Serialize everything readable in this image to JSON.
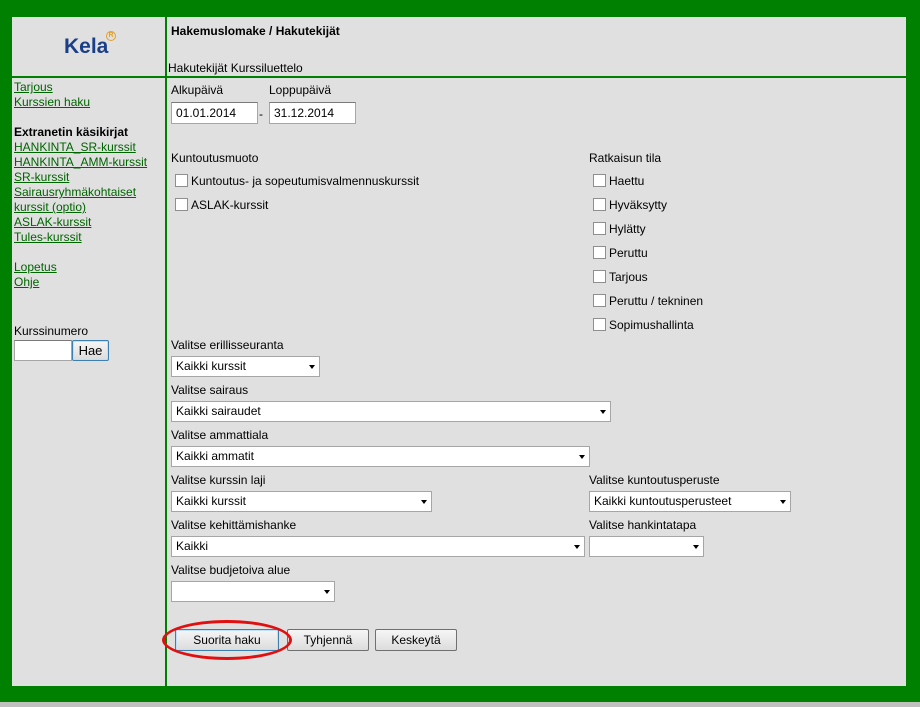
{
  "logo": {
    "text": "Kela",
    "mark": "R"
  },
  "header": {
    "title": "Hakemuslomake / Hakutekijät",
    "subtitle": "Hakutekijät Kurssiluettelo"
  },
  "sidebar": {
    "links_top": [
      "Tarjous",
      "Kurssien haku"
    ],
    "manuals_heading": "Extranetin käsikirjat",
    "manuals": [
      "HANKINTA_SR-kurssit",
      "HANKINTA_AMM-kurssit",
      "SR-kurssit",
      "Sairausryhmäkohtaiset",
      "kurssit (optio)",
      "ASLAK-kurssit",
      "Tules-kurssit"
    ],
    "links_bottom": [
      "Lopetus",
      "Ohje"
    ],
    "course_number_label": "Kurssinumero",
    "course_number_value": "",
    "search_button": "Hae"
  },
  "form": {
    "start_label": "Alkupäivä",
    "end_label": "Loppupäivä",
    "start_value": "01.01.2014",
    "date_separator": "-",
    "end_value": "31.12.2014",
    "rehab_type_label": "Kuntoutusmuoto",
    "rehab_types": [
      "Kuntoutus- ja sopeutumisvalmennuskurssit",
      "ASLAK-kurssit"
    ],
    "decision_label": "Ratkaisun tila",
    "decision_states": [
      "Haettu",
      "Hyväksytty",
      "Hylätty",
      "Peruttu",
      "Tarjous",
      "Peruttu / tekninen",
      "Sopimushallinta"
    ],
    "followup_label": "Valitse erillisseuranta",
    "followup_value": "Kaikki kurssit",
    "illness_label": "Valitse sairaus",
    "illness_value": "Kaikki sairaudet",
    "profession_label": "Valitse ammattiala",
    "profession_value": "Kaikki ammatit",
    "course_type_label": "Valitse kurssin laji",
    "course_type_value": "Kaikki kurssit",
    "rehab_basis_label": "Valitse kuntoutusperuste",
    "rehab_basis_value": "Kaikki kuntoutusperusteet",
    "development_label": "Valitse kehittämishanke",
    "development_value": "Kaikki",
    "procurement_label": "Valitse hankintatapa",
    "procurement_value": "",
    "budget_label": "Valitse budjetoiva alue",
    "budget_value": ""
  },
  "buttons": {
    "search": "Suorita haku",
    "clear": "Tyhjennä",
    "cancel": "Keskeytä"
  },
  "colors": {
    "frame": "#008000",
    "panel": "#e0e0e0",
    "link": "#006400",
    "highlight_ring": "#e01010",
    "logo": "#1a3f88"
  }
}
